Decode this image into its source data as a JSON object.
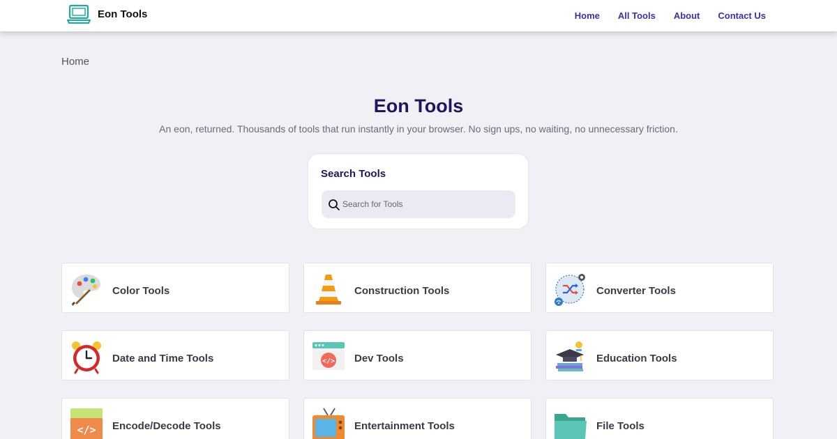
{
  "navbar": {
    "brand_name": "Eon Tools",
    "brand_icon": "laptop-icon",
    "links": [
      {
        "label": "Home"
      },
      {
        "label": "All Tools"
      },
      {
        "label": "About"
      },
      {
        "label": "Contact Us"
      }
    ]
  },
  "breadcrumb": "Home",
  "hero": {
    "title": "Eon Tools",
    "subtitle": "An eon, returned. Thousands of tools that run instantly in your browser. No sign ups, no waiting, no unnecessary friction."
  },
  "search": {
    "title": "Search Tools",
    "placeholder": "Search for Tools",
    "value": ""
  },
  "categories": [
    {
      "label": "Color Tools",
      "icon": "palette-icon"
    },
    {
      "label": "Construction Tools",
      "icon": "traffic-cone-icon"
    },
    {
      "label": "Converter Tools",
      "icon": "converter-icon"
    },
    {
      "label": "Date and Time Tools",
      "icon": "alarm-clock-icon"
    },
    {
      "label": "Dev Tools",
      "icon": "code-window-icon"
    },
    {
      "label": "Education Tools",
      "icon": "graduation-cap-icon"
    },
    {
      "label": "Encode/Decode Tools",
      "icon": "code-file-icon"
    },
    {
      "label": "Entertainment Tools",
      "icon": "tv-icon"
    },
    {
      "label": "File Tools",
      "icon": "folder-icon"
    }
  ],
  "colors": {
    "accent": "#3e2fa8",
    "title": "#22145e",
    "background": "#f0f0f5"
  }
}
